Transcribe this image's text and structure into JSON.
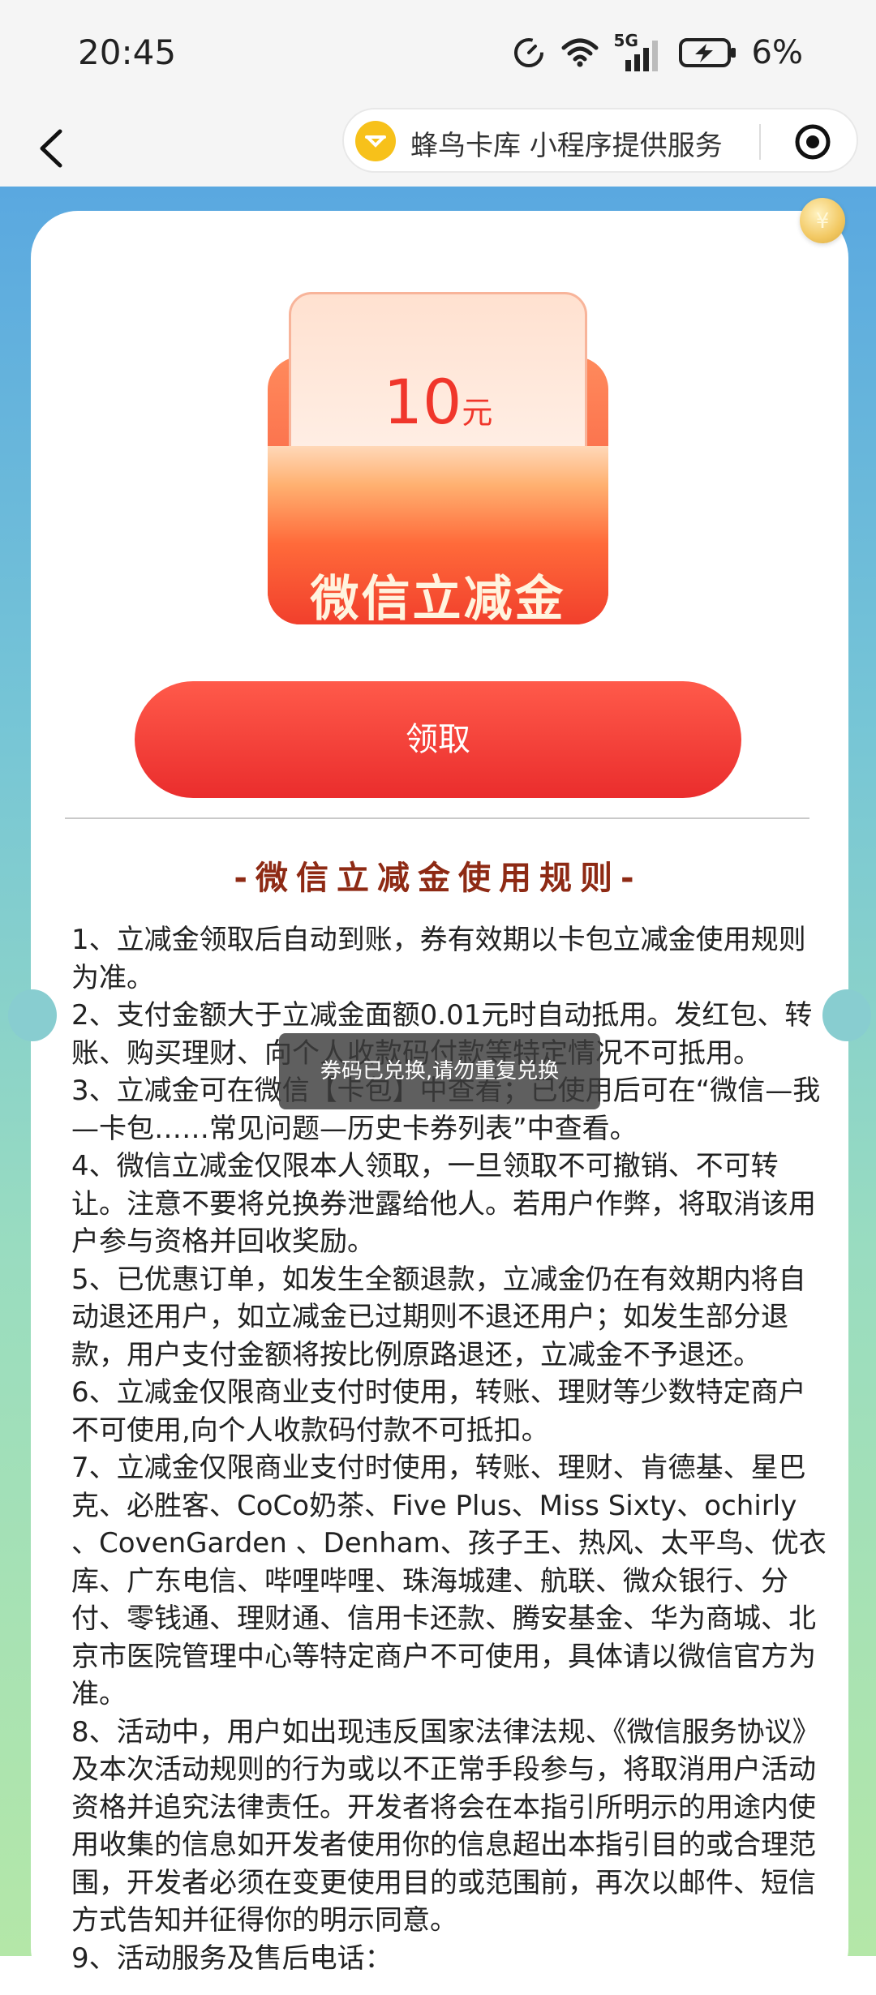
{
  "status_bar": {
    "time": "20:45",
    "network": "5G",
    "battery": "6%"
  },
  "nav": {
    "mini_program_name": "蜂鸟卡库 小程序提供服务",
    "logo_glyph": "ㄨ"
  },
  "voucher": {
    "amount": "10",
    "unit": "元",
    "title": "微信立减金"
  },
  "claim_button_label": "领取",
  "rules_title": "-微信立减金使用规则-",
  "rules": [
    "1、立减金领取后自动到账，券有效期以卡包立减金使用规则为准。",
    "2、支付金额大于立减金面额0.01元时自动抵用。发红包、转账、购买理财、向个人收款码付款等特定情况不可抵用。",
    "3、立减金可在微信【卡包】中查看；已使用后可在“微信—我—卡包……常见问题—历史卡券列表”中查看。",
    "4、微信立减金仅限本人领取，一旦领取不可撤销、不可转让。注意不要将兑换券泄露给他人。若用户作弊，将取消该用户参与资格并回收奖励。",
    "5、已优惠订单，如发生全额退款，立减金仍在有效期内将自动退还用户，如立减金已过期则不退还用户；如发生部分退款，用户支付金额将按比例原路退还，立减金不予退还。",
    "6、立减金仅限商业支付时使用，转账、理财等少数特定商户不可使用,向个人收款码付款不可抵扣。",
    "7、立减金仅限商业支付时使用，转账、理财、肯德基、星巴克、必胜客、CoCo奶茶、Five Plus、Miss Sixty、ochirly 、CovenGarden 、Denham、孩子王、热风、太平鸟、优衣库、广东电信、哔哩哔哩、珠海城建、航联、微众银行、分付、零钱通、理财通、信用卡还款、腾安基金、华为商城、北京市医院管理中心等特定商户不可使用，具体请以微信官方为准。",
    "8、活动中，用户如出现违反国家法律法规、《微信服务协议》及本次活动规则的行为或以不正常手段参与，将取消用户活动资格并追究法律责任。开发者将会在本指引所明示的用途内使用收集的信息如开发者使用你的信息超出本指引目的或合理范围，开发者必须在变更使用目的或范围前，再次以邮件、短信方式告知并征得你的明示同意。",
    "9、活动服务及售后电话："
  ],
  "toast": "券码已兑换,请勿重复兑换",
  "colors": {
    "accent_red": "#ea2d2d",
    "rules_title": "#8e2a14",
    "bg_top": "#5aa8e0",
    "bg_bottom": "#b4e7a8"
  }
}
